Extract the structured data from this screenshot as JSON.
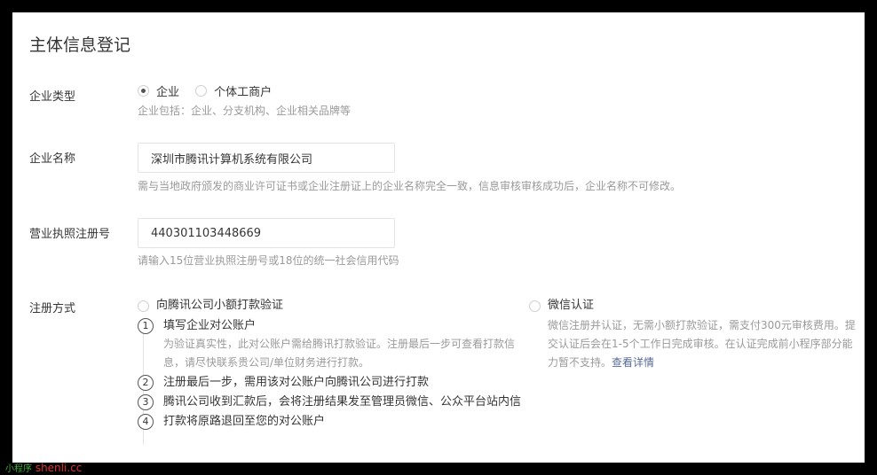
{
  "title": "主体信息登记",
  "enterprise_type": {
    "label": "企业类型",
    "options": [
      "企业",
      "个体工商户"
    ],
    "selected": 0,
    "hint": "企业包括：企业、分支机构、企业相关品牌等"
  },
  "enterprise_name": {
    "label": "企业名称",
    "value": "深圳市腾讯计算机系统有限公司",
    "hint": "需与当地政府颁发的商业许可证书或企业注册证上的企业名称完全一致，信息审核审核成功后，企业名称不可修改。"
  },
  "license_number": {
    "label": "营业执照注册号",
    "value": "440301103448669",
    "hint": "请输入15位营业执照注册号或18位的统一社会信用代码"
  },
  "registration": {
    "label": "注册方式",
    "transfer_option": {
      "label": "向腾讯公司小额打款验证",
      "steps": [
        {
          "num": "1",
          "text": "填写企业对公账户",
          "desc": "为验证真实性，此对公账户需给腾讯打款验证。注册最后一步可查看打款信息，请尽快联系贵公司/单位财务进行打款。"
        },
        {
          "num": "2",
          "text": "注册最后一步，需用该对公账户向腾讯公司进行打款",
          "desc": ""
        },
        {
          "num": "3",
          "text": "腾讯公司收到汇款后，会将注册结果发至管理员微信、公众平台站内信",
          "desc": ""
        },
        {
          "num": "4",
          "text": "打款将原路退回至您的对公账户",
          "desc": ""
        }
      ]
    },
    "wechat_option": {
      "label": "微信认证",
      "desc": "微信注册并认证，无需小额打款验证，需支付300元审核费用。提交认证后会在1-5个工作日完成审核。在认证完成前小程序部分能力暂不支持。",
      "link": "查看详情"
    }
  },
  "watermark": {
    "part1": "小程序",
    "part2": " shenli.cc"
  }
}
